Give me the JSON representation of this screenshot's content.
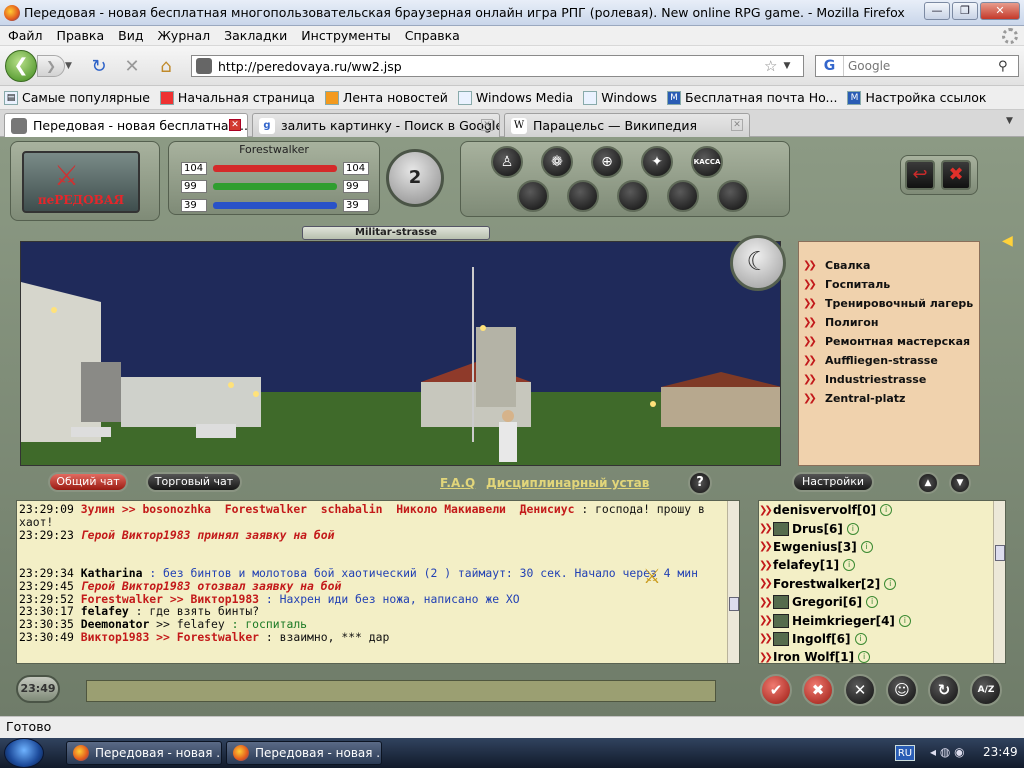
{
  "window": {
    "title": "Передовая - новая бесплатная многопользовательская браузерная онлайн игра РПГ (ролевая). New online RPG game. - Mozilla Firefox",
    "minimize": "—",
    "maximize": "❐",
    "close": "✕"
  },
  "menu": [
    "Файл",
    "Правка",
    "Вид",
    "Журнал",
    "Закладки",
    "Инструменты",
    "Справка"
  ],
  "nav": {
    "url": "http://peredovaya.ru/ww2.jsp",
    "search_placeholder": "Google",
    "search_engine_logo": "G"
  },
  "bookmarks": [
    {
      "label": "Самые популярные",
      "icon": "bookmarks-icon"
    },
    {
      "label": "Начальная страница",
      "icon": "firefox-icon"
    },
    {
      "label": "Лента новостей",
      "icon": "rss-icon"
    },
    {
      "label": "Windows Media",
      "icon": "page-icon"
    },
    {
      "label": "Windows",
      "icon": "page-icon"
    },
    {
      "label": "Бесплатная почта Ho...",
      "icon": "hotmail-icon"
    },
    {
      "label": "Настройка ссылок",
      "icon": "hotmail-icon"
    }
  ],
  "tabs": [
    {
      "label": "Передовая - новая бесплатная ...",
      "icon": "peredovaya-icon",
      "active": true
    },
    {
      "label": "залить картинку - Поиск в Google",
      "icon": "google-icon",
      "active": false
    },
    {
      "label": "Парацельс — Википедия",
      "icon": "wikipedia-icon",
      "active": false
    }
  ],
  "game": {
    "logo_text": "пеРЕДОВАЯ",
    "player_name": "Forestwalker",
    "stats": [
      {
        "left": "104",
        "right": "104",
        "color": "#d42a2a"
      },
      {
        "left": "99",
        "right": "99",
        "color": "#2f9e2f"
      },
      {
        "left": "39",
        "right": "39",
        "color": "#2952c8"
      }
    ],
    "level": "2",
    "cashier_label": "КАССА",
    "location": "Militar-strasse",
    "map_locations": [
      "Свалка",
      "Госпиталь",
      "Тренировочный лагерь",
      "Полигон",
      "Ремонтная мастерская",
      "Auffliegen-strasse",
      "Industriestrasse",
      "Zentral-platz"
    ],
    "chat_tabs": {
      "general": "Общий чат",
      "trade": "Торговый чат"
    },
    "links": {
      "faq": "F.A.Q",
      "rules": "Дисциплинарный устав"
    },
    "help": "?",
    "settings": "Настройки",
    "chat_lines": [
      {
        "time": "23:29:09",
        "parts": [
          {
            "cls": "n",
            "text": "Зулин >> bosonozhka  Forestwalker  schabalin  Николо Макиавели  Денисиус"
          },
          {
            "cls": "blk",
            "text": " : господа! прошу в хаот!"
          }
        ]
      },
      {
        "time": "23:29:23",
        "parts": [
          {
            "cls": "sys",
            "text": "Герой Виктор1983 принял заявку на бой"
          }
        ]
      },
      {
        "time": "",
        "parts": [
          {
            "cls": "blk",
            "text": " "
          }
        ]
      },
      {
        "time": "",
        "parts": [
          {
            "cls": "blk",
            "text": " "
          }
        ]
      },
      {
        "time": "23:29:34",
        "parts": [
          {
            "cls": "nb",
            "text": "Katharina"
          },
          {
            "cls": "blue",
            "text": " : без бинтов и молотова бой хаотический (2 ) таймаут: 30 сек. Начало через 4 мин"
          }
        ]
      },
      {
        "time": "23:29:45",
        "parts": [
          {
            "cls": "sys",
            "text": "Герой Виктор1983 отозвал заявку на бой"
          }
        ]
      },
      {
        "time": "23:29:52",
        "parts": [
          {
            "cls": "n",
            "text": "Forestwalker >> Виктор1983"
          },
          {
            "cls": "blue",
            "text": " : Нахрен иди без ножа, написано же ХО"
          }
        ]
      },
      {
        "time": "23:30:17",
        "parts": [
          {
            "cls": "nb",
            "text": "felafey"
          },
          {
            "cls": "blk",
            "text": " : где взять бинты?"
          }
        ]
      },
      {
        "time": "23:30:35",
        "parts": [
          {
            "cls": "nb",
            "text": "Deemonator"
          },
          {
            "cls": "blk",
            "text": " >> felafey "
          },
          {
            "cls": "green",
            "text": ": госпиталь"
          }
        ]
      },
      {
        "time": "23:30:49",
        "parts": [
          {
            "cls": "n",
            "text": "Виктор1983 >> Forestwalker"
          },
          {
            "cls": "blk",
            "text": " : взаимно, *** дар"
          }
        ]
      }
    ],
    "users": [
      {
        "name": "denisvervolf[0]",
        "clan": false
      },
      {
        "name": "Drus[6]",
        "clan": true
      },
      {
        "name": "Ewgenius[3]",
        "clan": false
      },
      {
        "name": "felafey[1]",
        "clan": false
      },
      {
        "name": "Forestwalker[2]",
        "clan": false
      },
      {
        "name": "Gregori[6]",
        "clan": true
      },
      {
        "name": "Heimkrieger[4]",
        "clan": true
      },
      {
        "name": "Ingolf[6]",
        "clan": true
      },
      {
        "name": "Iron Wolf[1]",
        "clan": false
      }
    ],
    "chat_time": "23:49",
    "chat_input": "",
    "az_label": "A/Z"
  },
  "status": "Готово",
  "taskbar": {
    "items": [
      "Передовая - новая ...",
      "Передовая - новая ..."
    ],
    "lang": "RU",
    "time": "23:49"
  }
}
